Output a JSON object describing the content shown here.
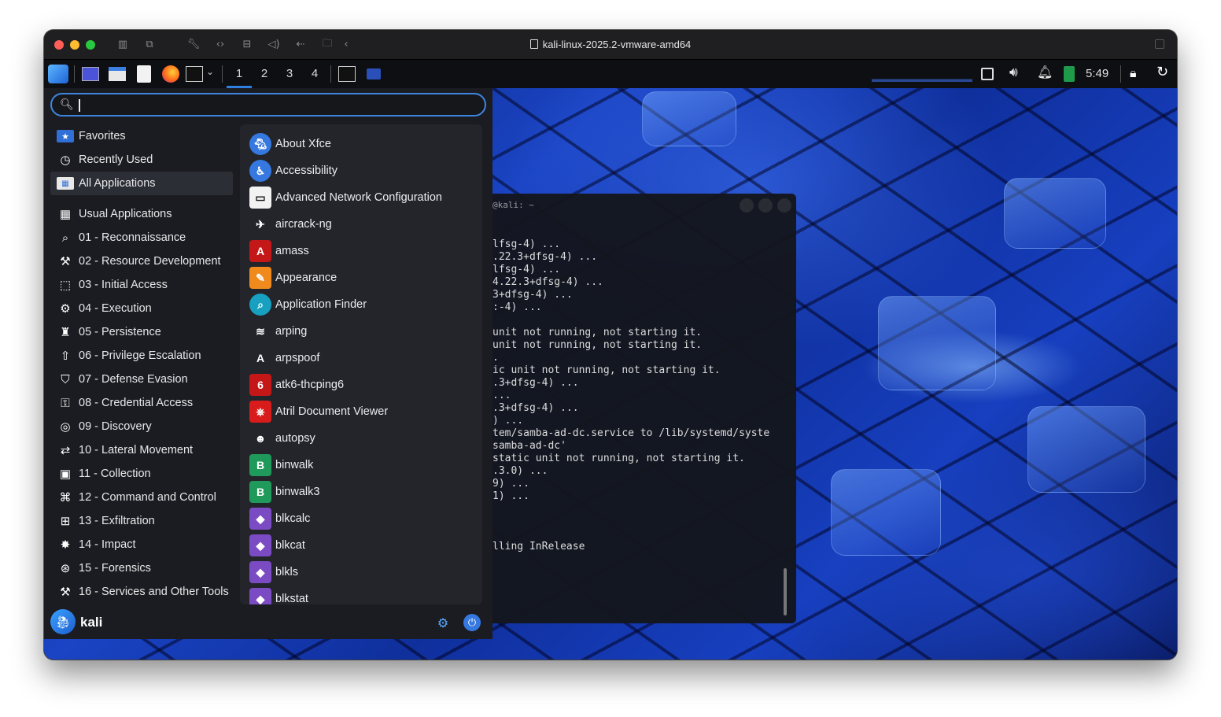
{
  "window": {
    "title": "kali-linux-2025.2-vmware-amd64"
  },
  "panel": {
    "workspaces": [
      "1",
      "2",
      "3",
      "4"
    ],
    "active_workspace": "1",
    "clock": "5:49"
  },
  "menu": {
    "search_value": "",
    "categories_top": [
      "Favorites",
      "Recently Used",
      "All Applications"
    ],
    "categories": [
      "Usual Applications",
      "01 - Reconnaissance",
      "02 - Resource Development",
      "03 - Initial Access",
      "04 - Execution",
      "05 - Persistence",
      "06 - Privilege Escalation",
      "07 - Defense Evasion",
      "08 - Credential Access",
      "09 - Discovery",
      "10 - Lateral Movement",
      "11 - Collection",
      "12 - Command and Control",
      "13 - Exfiltration",
      "14 - Impact",
      "15 - Forensics",
      "16 - Services and Other Tools"
    ],
    "apps": [
      "About Xfce",
      "Accessibility",
      "Advanced Network Configuration",
      "aircrack-ng",
      "amass",
      "Appearance",
      "Application Finder",
      "arping",
      "arpspoof",
      "atk6-thcping6",
      "Atril Document Viewer",
      "autopsy",
      "binwalk",
      "binwalk3",
      "blkcalc",
      "blkcat",
      "blkls",
      "blkstat"
    ],
    "user": "kali"
  },
  "terminal": {
    "title": "@kali: ~",
    "lines": [
      "lfsg-4) ...",
      ".22.3+dfsg-4) ...",
      "lfsg-4) ...",
      "4.22.3+dfsg-4) ...",
      "3+dfsg-4) ...",
      ":-4) ...",
      "",
      "unit not running, not starting it.",
      "unit not running, not starting it.",
      ".",
      "ic unit not running, not starting it.",
      ".3+dfsg-4) ...",
      "...",
      ".3+dfsg-4) ...",
      ") ...",
      "tem/samba-ad-dc.service to /lib/systemd/syste",
      "samba-ad-dc'",
      "static unit not running, not starting it.",
      ".3.0) ...",
      "9) ...",
      "1) ...",
      "",
      "",
      "",
      "lling InRelease"
    ]
  },
  "colors": {
    "accent": "#3d86e0",
    "menu_bg": "#1b1c21",
    "apps_bg": "#24252b",
    "panel_bg": "#0e0f12"
  }
}
